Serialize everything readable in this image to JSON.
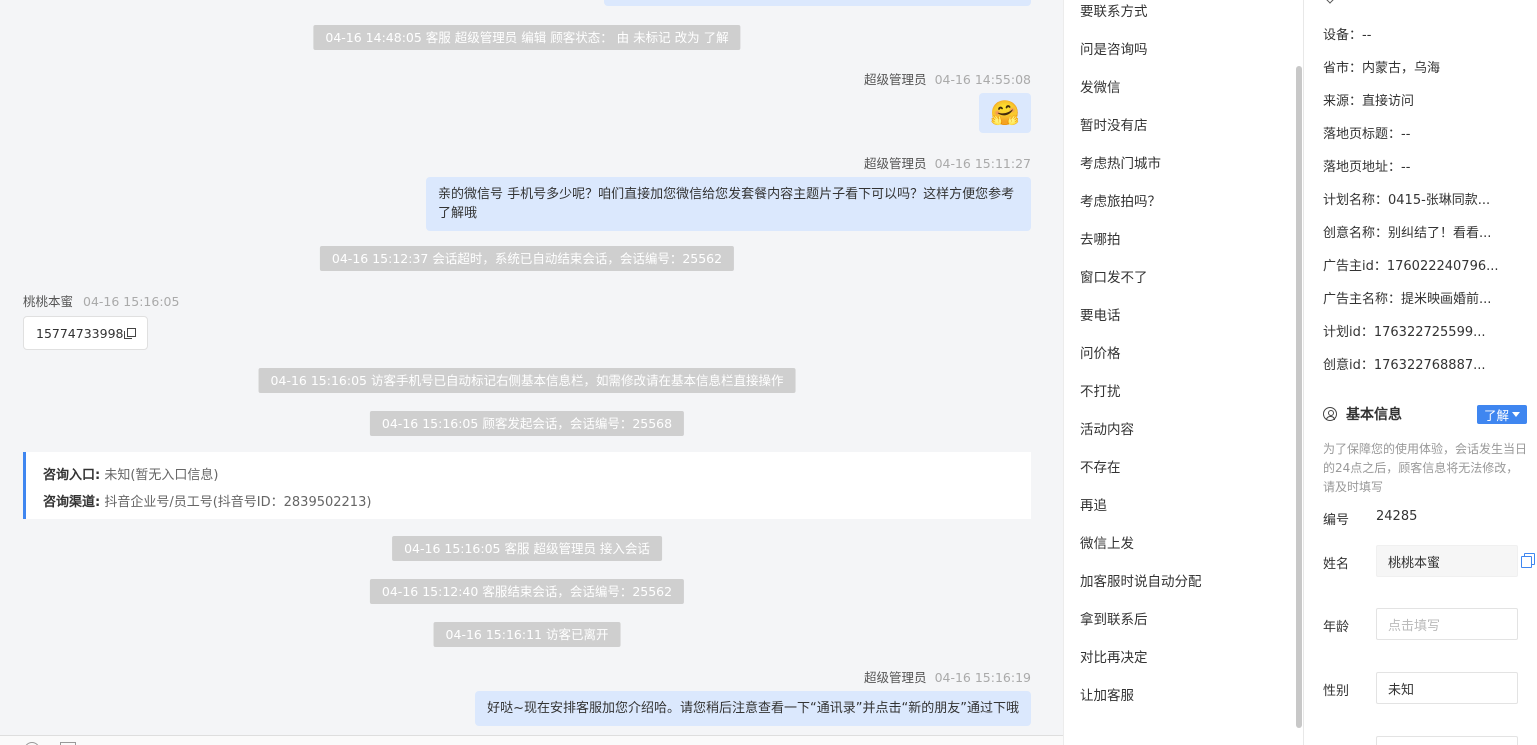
{
  "chat": {
    "system_messages": [
      "04-16 14:48:05 客服 超级管理员 编辑 顾客状态： 由 未标记 改为 了解",
      "04-16 15:12:37 会话超时，系统已自动结束会话，会话编号：25562",
      "04-16 15:16:05 访客手机号已自动标记右侧基本信息栏，如需修改请在基本信息栏直接操作",
      "04-16 15:16:05 顾客发起会话，会话编号：25568",
      "04-16 15:16:05 客服 超级管理员 接入会话",
      "04-16 15:12:40 客服结束会话，会话编号：25562",
      "04-16 15:16:11 访客已离开"
    ],
    "agent_name": "超级管理员",
    "agent_times": [
      "04-16 14:55:08",
      "04-16 15:11:27",
      "04-16 15:16:19"
    ],
    "agent_msg_1": "亲的微信号 手机号多少呢？咱们直接加您微信给您发套餐内容主题片子看下可以吗？这样方便您参考了解哦",
    "agent_msg_2": "好哒~现在安排客服加您介绍哈。请您稍后注意查看一下“通讯录”并点击“新的朋友”通过下哦",
    "emoji": "🤗",
    "visitor_name": "桃桃本蜜",
    "visitor_time": "04-16 15:16:05",
    "visitor_phone": "15774733998",
    "consult": {
      "entry_label": "咨询入口:",
      "entry_value": "未知(暂无入口信息)",
      "channel_label": "咨询渠道:",
      "channel_value": "抖音企业号/员工号(抖音号ID：2839502213)"
    }
  },
  "quick_replies": [
    "要联系方式",
    "问是咨询吗",
    "发微信",
    "暂时没有店",
    "考虑热门城市",
    "考虑旅拍吗？",
    "去哪拍",
    "窗口发不了",
    "要电话",
    "问价格",
    "不打扰",
    "活动内容",
    "不存在",
    "再追",
    "微信上发",
    "加客服时说自动分配",
    "拿到联系后",
    "对比再决定",
    "让加客服"
  ],
  "info": {
    "rows": [
      "设备：--",
      "省市：内蒙古，乌海",
      "来源：直接访问",
      "落地页标题：--",
      "落地页地址：--",
      "计划名称：0415-张琳同款...",
      "创意名称：别纠结了！看看...",
      "广告主id：176022240796...",
      "广告主名称：提米映画婚前...",
      "计划id：176322725599...",
      "创意id：176322768887..."
    ],
    "basic_title": "基本信息",
    "status": "了解",
    "note": "为了保障您的使用体验，会话发生当日的24点之后，顾客信息将无法修改，请及时填写",
    "id_label": "编号",
    "id_value": "24285",
    "name_label": "姓名",
    "name_value": "桃桃本蜜",
    "age_label": "年龄",
    "age_placeholder": "点击填写",
    "gender_label": "性别",
    "gender_value": "未知"
  }
}
